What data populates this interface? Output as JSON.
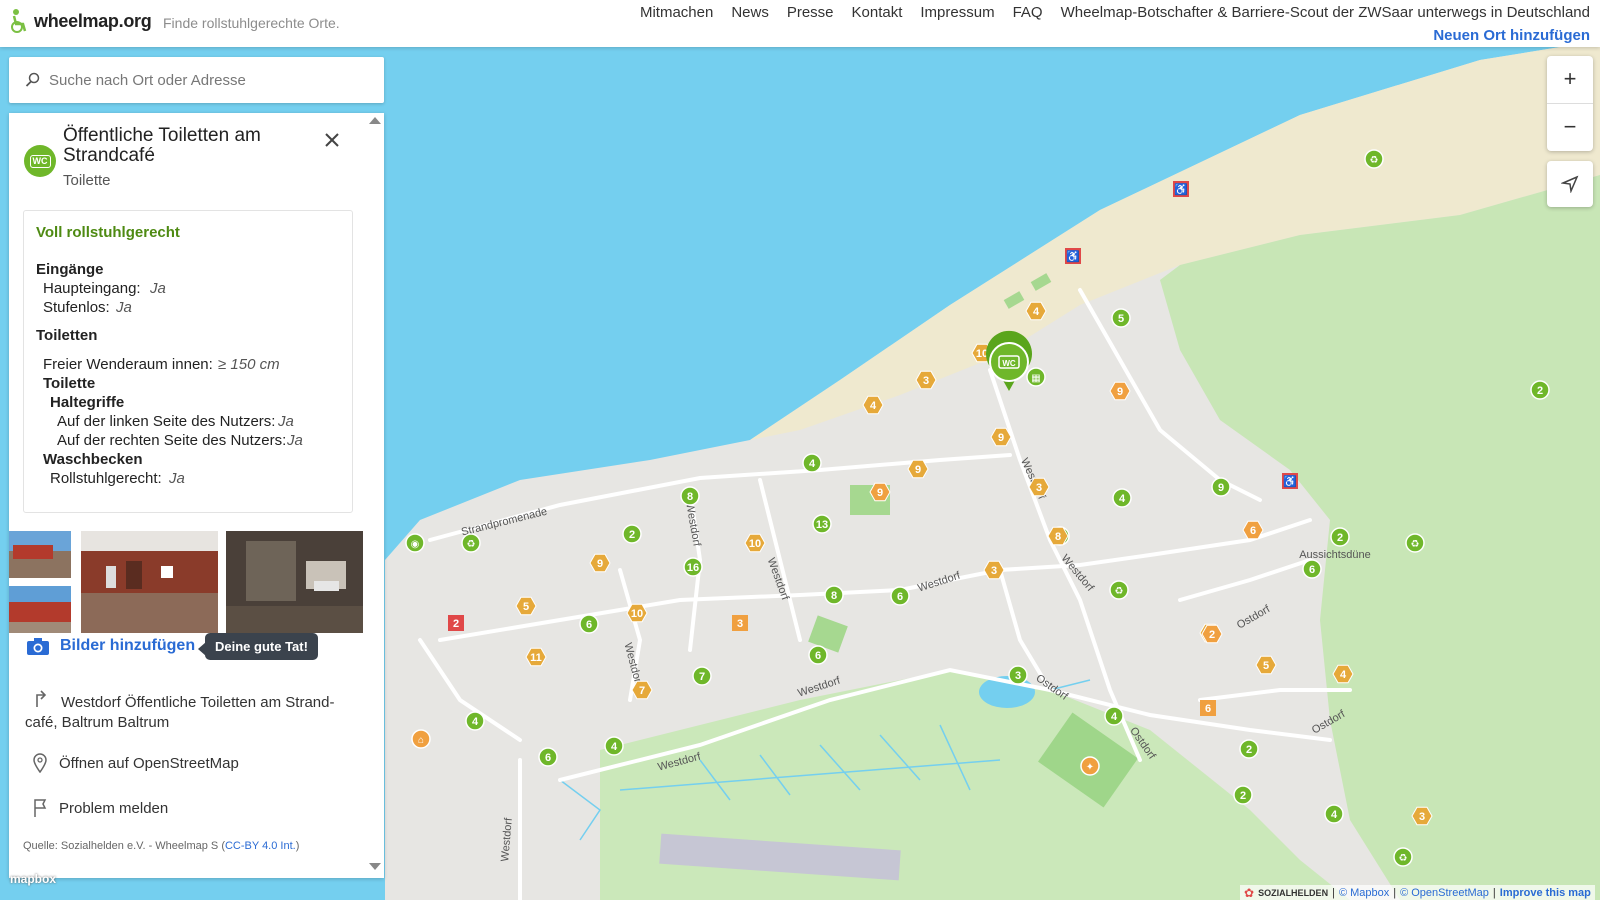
{
  "header": {
    "logo_text": "wheelmap.org",
    "tagline": "Finde rollstuhlgerechte Orte.",
    "nav": [
      "Mitmachen",
      "News",
      "Presse",
      "Kontakt",
      "Impressum",
      "FAQ",
      "Wheelmap-Botschafter & Barriere-Scout der ZWSaar unterwegs in Deutschland"
    ],
    "add_place": "Neuen Ort hinzufügen"
  },
  "search": {
    "placeholder": "Suche nach Ort oder Adresse"
  },
  "place": {
    "icon_label": "WC",
    "title": "Öffentliche Toiletten am Strandcafé",
    "category": "Toilette",
    "status": "Voll rollstuhlgerecht",
    "sections": {
      "eingaenge": {
        "title": "Eingänge",
        "haupteingang_label": "Haupteingang:",
        "haupteingang_value": "Ja",
        "stufenlos_label": "Stufenlos:",
        "stufenlos_value": "Ja"
      },
      "toiletten": {
        "title": "Toiletten",
        "wenderaum_label": "Freier Wenderaum innen:",
        "wenderaum_value": "≥ 150 cm",
        "toilette_title": "Toilette",
        "haltegriffe_title": "Haltegriffe",
        "links_label": "Auf der linken Seite des Nutzers:",
        "links_value": "Ja",
        "rechts_label": "Auf der rechten Seite des Nutzers:",
        "rechts_value": "Ja",
        "waschbecken_title": "Waschbecken",
        "rollstuhl_label": "Rollstuhlgerecht:",
        "rollstuhl_value": "Ja"
      }
    },
    "add_photos": "Bilder hinzufügen",
    "tooltip": "Deine gute Tat!",
    "address": "Westdorf Öffentliche Toiletten am Strand-café, Baltrum Baltrum",
    "osm_link": "Öffnen auf OpenStreetMap",
    "report": "Problem melden",
    "source_prefix": "Quelle: Sozialhelden e.V. - Wheelmap S (",
    "source_license": "CC-BY 4.0 Int.",
    "source_suffix": ")"
  },
  "map": {
    "street_labels": [
      "Strandpromenade",
      "Westdorf",
      "Westdorf",
      "Westdorf",
      "Westdorf",
      "Westdorf",
      "Westdorf",
      "Westdorf",
      "Westdorf",
      "Westdorf",
      "Ostdorf",
      "Ostdorf",
      "Ostdorf",
      "Ostdorf",
      "Aussichtsdüne"
    ],
    "cluster_counts_green": [
      "5",
      "2",
      "6",
      "4",
      "9",
      "6",
      "13",
      "16",
      "8",
      "8",
      "7",
      "6",
      "2",
      "6",
      "6",
      "4",
      "4",
      "3",
      "4",
      "2",
      "2",
      "4",
      "4",
      "2",
      "8"
    ],
    "cluster_counts_yellow": [
      "4",
      "3",
      "4",
      "9",
      "9",
      "9",
      "3",
      "3",
      "10",
      "5",
      "11",
      "10",
      "7",
      "2",
      "5",
      "4",
      "10",
      "8",
      "3"
    ],
    "cluster_counts_orange": [
      "9",
      "9",
      "6",
      "2"
    ],
    "square_counts_orange": [
      "3",
      "6"
    ],
    "square_counts_red": [
      "2"
    ]
  },
  "controls": {
    "zoom_in": "+",
    "zoom_out": "−"
  },
  "attribution": {
    "sozialhelden": "SOZIALHELDEN",
    "mapbox": "© Mapbox",
    "osm": "© OpenStreetMap",
    "improve": "Improve this map"
  },
  "mapbox_logo": "mapbox",
  "colors": {
    "water": "#74cfef",
    "beach": "#efe9cf",
    "land": "#e6e6e4",
    "green": "#c7e5b5",
    "marker_green": "#6fb72a",
    "marker_yellow": "#e6a93a",
    "marker_orange": "#f0a040",
    "marker_red": "#e04848",
    "link_blue": "#2a6bd4"
  }
}
